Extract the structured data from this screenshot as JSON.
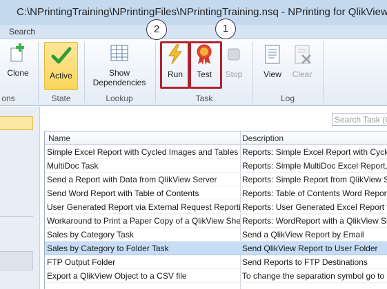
{
  "window": {
    "title": "C:\\NPrintingTraining\\NPrintingFiles\\NPrintingTraining.nsq - NPrinting for QlikView"
  },
  "menu": {
    "search": "Search"
  },
  "ribbon": {
    "buttons": {
      "clone": "Clone",
      "active": "Active",
      "show_dependencies": "Show Dependencies",
      "run": "Run",
      "test": "Test",
      "stop": "Stop",
      "view": "View",
      "clear": "Clear"
    },
    "groups": {
      "actions": "ons",
      "state": "State",
      "lookup": "Lookup",
      "task": "Task",
      "log": "Log"
    },
    "callouts": {
      "run": "2",
      "test": "1"
    }
  },
  "search": {
    "placeholder": "Search Task (C"
  },
  "table": {
    "columns": [
      "Name",
      "Description"
    ],
    "rows": [
      {
        "name": "Simple Excel Report with Cycled Images and Tables",
        "description": "Reports: Simple Excel Report with Cycle"
      },
      {
        "name": "MultiDoc Task",
        "description": "Reports: Simple MultiDoc Excel Report, S"
      },
      {
        "name": "Send a Report with Data from QlikView Server",
        "description": "Reports: Simple Report from QlikView Se"
      },
      {
        "name": "Send Word Report with Table of Contents",
        "description": "Reports: Table of Contents Word Report,"
      },
      {
        "name": "User Generated Report via External Request Reporting",
        "description": "Reports: User Generated Excel Report via"
      },
      {
        "name": "Workaround to Print a Paper Copy of a QlikView Shee",
        "description": "Reports: WordReport with a QlikView She"
      },
      {
        "name": "Sales by Category Task",
        "description": "Send a QlikView Report by Email"
      },
      {
        "name": "Sales by Category to Folder Task",
        "description": "Send QlikView Report to User Folder"
      },
      {
        "name": "FTP Output Folder",
        "description": "Send Reports to FTP Destinations"
      },
      {
        "name": "Export a QlikView Object to a CSV file",
        "description": "To change the separation symbol go to"
      }
    ],
    "selected_row": 7
  },
  "colors": {
    "highlight_box": "#b0232e",
    "active_bg": "#f9d65c",
    "selected_row": "#c7dcf5"
  }
}
